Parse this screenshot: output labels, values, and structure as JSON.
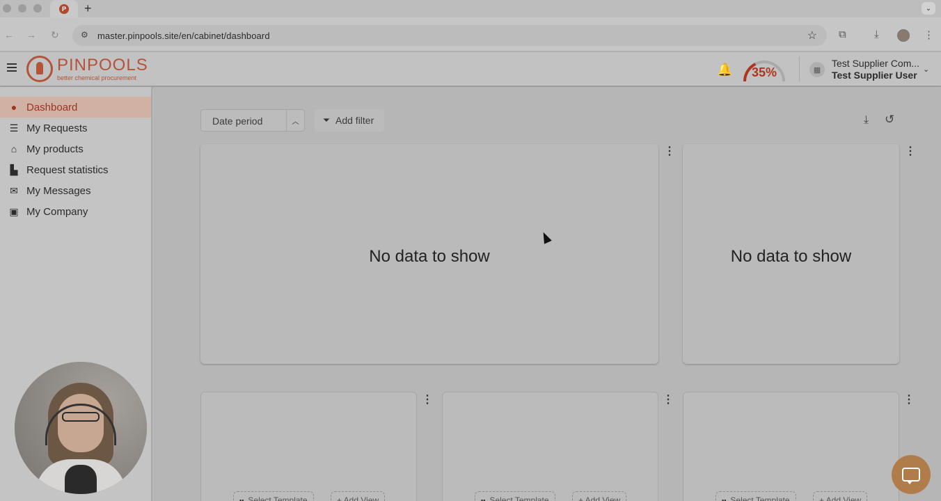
{
  "browser": {
    "url": "master.pinpools.site/en/cabinet/dashboard",
    "new_tab": "+",
    "tab_favicon": "P"
  },
  "header": {
    "logo_text": "PINPOOLS",
    "logo_tagline": "better chemical procurement",
    "profile_progress": "35%",
    "profile_progress_value": 0.35,
    "company_name": "Test Supplier Com...",
    "user_name": "Test Supplier User",
    "accent_color": "#b0351f"
  },
  "sidebar": {
    "items": [
      {
        "label": "Dashboard",
        "icon": "palette-icon",
        "glyph": "●",
        "active": true
      },
      {
        "label": "My Requests",
        "icon": "list-icon",
        "glyph": "☰",
        "active": false
      },
      {
        "label": "My products",
        "icon": "basket-icon",
        "glyph": "⌂",
        "active": false
      },
      {
        "label": "Request statistics",
        "icon": "bar-chart-icon",
        "glyph": "▙",
        "active": false
      },
      {
        "label": "My Messages",
        "icon": "comments-icon",
        "glyph": "✉",
        "active": false
      },
      {
        "label": "My Company",
        "icon": "briefcase-icon",
        "glyph": "▣",
        "active": false
      }
    ]
  },
  "filters": {
    "date_period": "Date period",
    "add_filter": "Add filter"
  },
  "widgets": {
    "empty_text": "No data to show",
    "select_template": "Select Template",
    "add_view": "+ Add View"
  }
}
